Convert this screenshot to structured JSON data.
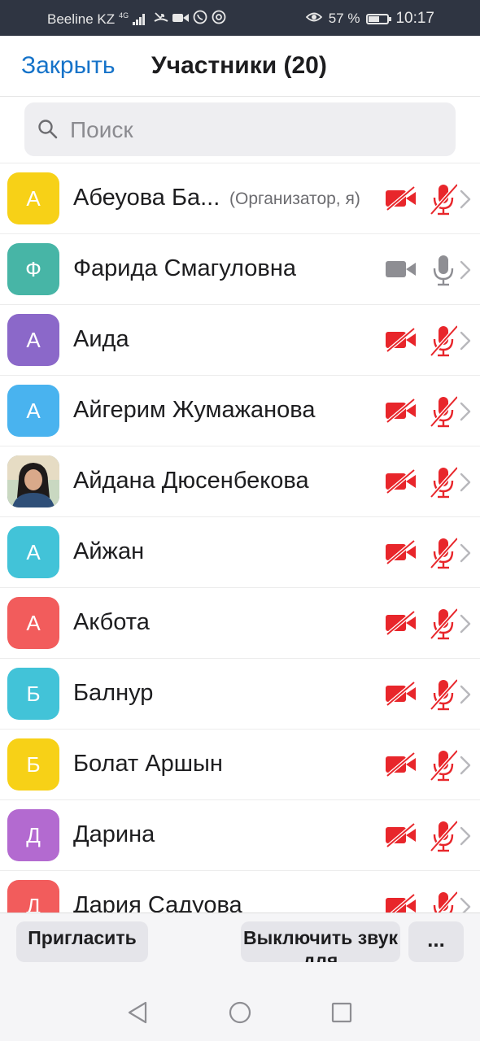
{
  "status_bar": {
    "carrier": "Beeline KZ",
    "network": "4G",
    "battery": "57 %",
    "battery_level": 0.57,
    "time": "10:17"
  },
  "header": {
    "close_label": "Закрыть",
    "title": "Участники (20)"
  },
  "search": {
    "placeholder": "Поиск"
  },
  "participants": [
    {
      "initial": "А",
      "color": "#f7d117",
      "name": "Абеуова Ба...",
      "role": "(Организатор, я)",
      "video_on": false,
      "audio_on": false
    },
    {
      "initial": "Ф",
      "color": "#47b5a6",
      "name": "Фарида Смагуловна",
      "role": "",
      "video_on": true,
      "audio_on": true
    },
    {
      "initial": "А",
      "color": "#8b68c9",
      "name": "Аида",
      "role": "",
      "video_on": false,
      "audio_on": false
    },
    {
      "initial": "А",
      "color": "#49b3ef",
      "name": "Айгерим Жумажанова",
      "role": "",
      "video_on": false,
      "audio_on": false
    },
    {
      "initial": "",
      "color": "#6a7d8e",
      "name": "Айдана Дюсенбекова",
      "role": "",
      "video_on": false,
      "audio_on": false,
      "photo": true
    },
    {
      "initial": "А",
      "color": "#42c3d8",
      "name": "Айжан",
      "role": "",
      "video_on": false,
      "audio_on": false
    },
    {
      "initial": "А",
      "color": "#f25c5c",
      "name": "Акбота",
      "role": "",
      "video_on": false,
      "audio_on": false
    },
    {
      "initial": "Б",
      "color": "#42c3d8",
      "name": "Балнур",
      "role": "",
      "video_on": false,
      "audio_on": false
    },
    {
      "initial": "Б",
      "color": "#f7d117",
      "name": "Болат Аршын",
      "role": "",
      "video_on": false,
      "audio_on": false
    },
    {
      "initial": "Д",
      "color": "#b36ad0",
      "name": "Дарина",
      "role": "",
      "video_on": false,
      "audio_on": false
    },
    {
      "initial": "Д",
      "color": "#f25c5c",
      "name": "Дария Садуова",
      "role": "",
      "video_on": false,
      "audio_on": false
    }
  ],
  "bottom_bar": {
    "invite_label": "Пригласить",
    "mute_all_label": "Выключить звук для",
    "more_label": "..."
  },
  "colors": {
    "accent": "#1673c9",
    "muted_red": "#e8262b",
    "active_gray": "#8e8e93"
  }
}
